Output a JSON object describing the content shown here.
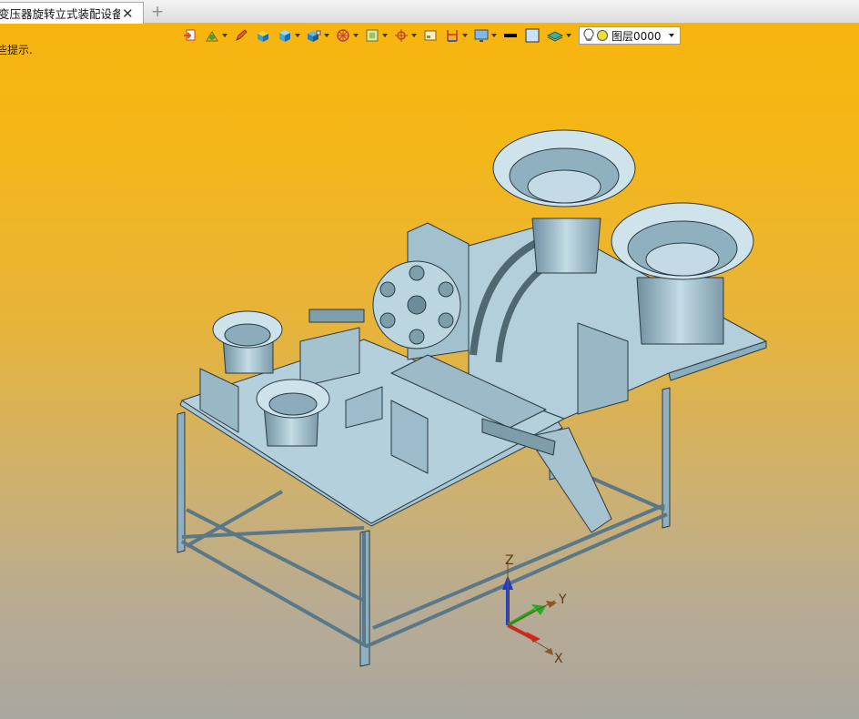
{
  "window": {
    "tab_title": "[转换后变压器旋转立式装配设备]",
    "tab_title_visible": "变压器旋转立式装配设备]",
    "close_glyph": "✕",
    "new_tab_glyph": "+"
  },
  "viewport": {
    "hint_text": "些提示.",
    "background_top": "#f8b40c",
    "background_bottom": "#aaa7a0"
  },
  "toolbar": {
    "icons": [
      "exit-sketch-icon",
      "tools-icon",
      "pencil-icon",
      "box-view-icon",
      "solid-cube-icon",
      "cube-view-icon",
      "wheel-icon",
      "frame-icon",
      "target-icon",
      "view-box-icon",
      "measure-icon",
      "screen-icon"
    ],
    "layer_label": "图层0000"
  },
  "axes": {
    "z": "Z",
    "y": "Y",
    "x": "X"
  }
}
